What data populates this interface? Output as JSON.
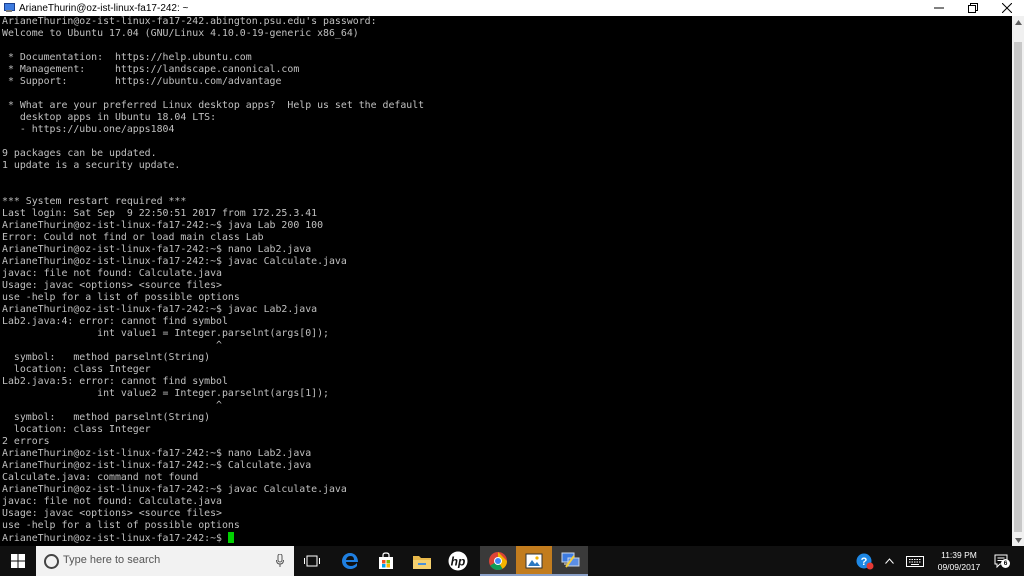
{
  "window": {
    "title": "ArianeThurin@oz-ist-linux-fa17-242: ~",
    "minimize": "minimize",
    "restore": "restore",
    "close": "close"
  },
  "terminal": {
    "lines": [
      "ArianeThurin@oz-ist-linux-fa17-242.abington.psu.edu's password:",
      "Welcome to Ubuntu 17.04 (GNU/Linux 4.10.0-19-generic x86_64)",
      "",
      " * Documentation:  https://help.ubuntu.com",
      " * Management:     https://landscape.canonical.com",
      " * Support:        https://ubuntu.com/advantage",
      "",
      " * What are your preferred Linux desktop apps?  Help us set the default",
      "   desktop apps in Ubuntu 18.04 LTS:",
      "   - https://ubu.one/apps1804",
      "",
      "9 packages can be updated.",
      "1 update is a security update.",
      "",
      "",
      "*** System restart required ***",
      "Last login: Sat Sep  9 22:50:51 2017 from 172.25.3.41",
      "ArianeThurin@oz-ist-linux-fa17-242:~$ java Lab 200 100",
      "Error: Could not find or load main class Lab",
      "ArianeThurin@oz-ist-linux-fa17-242:~$ nano Lab2.java",
      "ArianeThurin@oz-ist-linux-fa17-242:~$ javac Calculate.java",
      "javac: file not found: Calculate.java",
      "Usage: javac <options> <source files>",
      "use -help for a list of possible options",
      "ArianeThurin@oz-ist-linux-fa17-242:~$ javac Lab2.java",
      "Lab2.java:4: error: cannot find symbol",
      "                int value1 = Integer.parselnt(args[0]);",
      "                                    ^",
      "  symbol:   method parselnt(String)",
      "  location: class Integer",
      "Lab2.java:5: error: cannot find symbol",
      "                int value2 = Integer.parselnt(args[1]);",
      "                                    ^",
      "  symbol:   method parselnt(String)",
      "  location: class Integer",
      "2 errors",
      "ArianeThurin@oz-ist-linux-fa17-242:~$ nano Lab2.java",
      "ArianeThurin@oz-ist-linux-fa17-242:~$ Calculate.java",
      "Calculate.java: command not found",
      "ArianeThurin@oz-ist-linux-fa17-242:~$ javac Calculate.java",
      "javac: file not found: Calculate.java",
      "Usage: javac <options> <source files>",
      "use -help for a list of possible options"
    ],
    "prompt": "ArianeThurin@oz-ist-linux-fa17-242:~$ ",
    "cursor_color": "#00d000"
  },
  "taskbar": {
    "search_placeholder": "Type here to search",
    "time": "11:39 PM",
    "date": "09/09/2017",
    "notification_count": "6",
    "apps": [
      {
        "name": "edge-icon"
      },
      {
        "name": "store-icon"
      },
      {
        "name": "file-explorer-icon"
      },
      {
        "name": "hp-icon"
      },
      {
        "name": "chrome-icon"
      },
      {
        "name": "photos-icon"
      },
      {
        "name": "putty-icon"
      }
    ]
  },
  "colors": {
    "terminal_bg": "#000000",
    "terminal_fg": "#c0c0c0",
    "taskbar_bg": "#101010",
    "accent": "#c27c1e"
  }
}
